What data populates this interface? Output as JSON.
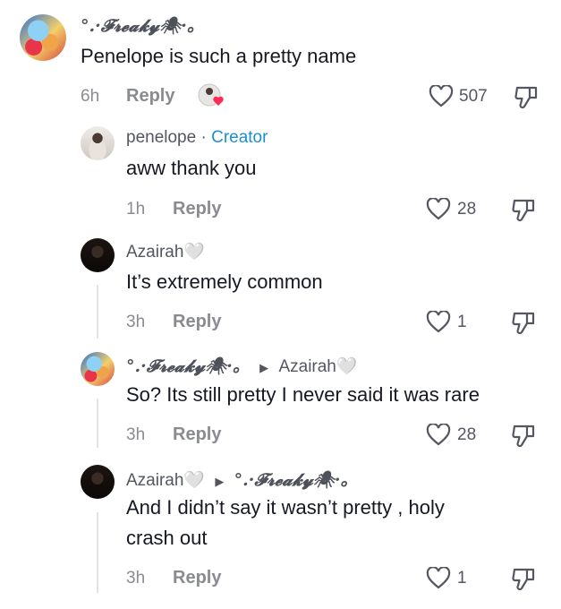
{
  "comments": [
    {
      "author": "°.·𝓕𝓻𝓮𝓪𝓴𝔂🕷·。",
      "text": "Penelope is such a pretty name",
      "time": "6h",
      "reply_label": "Reply",
      "likes": "507"
    },
    {
      "author": "penelope",
      "badge_sep": "·",
      "badge": "Creator",
      "text": "aww thank you",
      "time": "1h",
      "reply_label": "Reply",
      "likes": "28"
    },
    {
      "author": "Azairah🤍",
      "text": "It’s extremely common",
      "time": "3h",
      "reply_label": "Reply",
      "likes": "1"
    },
    {
      "author": "°.·𝓕𝓻𝓮𝓪𝓴𝔂🕷·。",
      "reply_to": "Azairah🤍",
      "text": "So? Its still pretty I never said it was rare",
      "time": "3h",
      "reply_label": "Reply",
      "likes": "28"
    },
    {
      "author": "Azairah🤍",
      "reply_to": "°.·𝓕𝓻𝓮𝓪𝓴𝔂🕷·。",
      "text_line1": "And I didn’t say it wasn’t pretty , holy",
      "text_line2": "crash out",
      "time": "3h",
      "reply_label": "Reply",
      "likes": "1"
    }
  ],
  "colors": {
    "creator": "#1a8fd1",
    "muted": "#8a8b91",
    "text": "#161823"
  },
  "icons": [
    "heart-outline-icon",
    "dislike-icon",
    "liked-by-creator-icon",
    "reply-arrow-icon"
  ]
}
